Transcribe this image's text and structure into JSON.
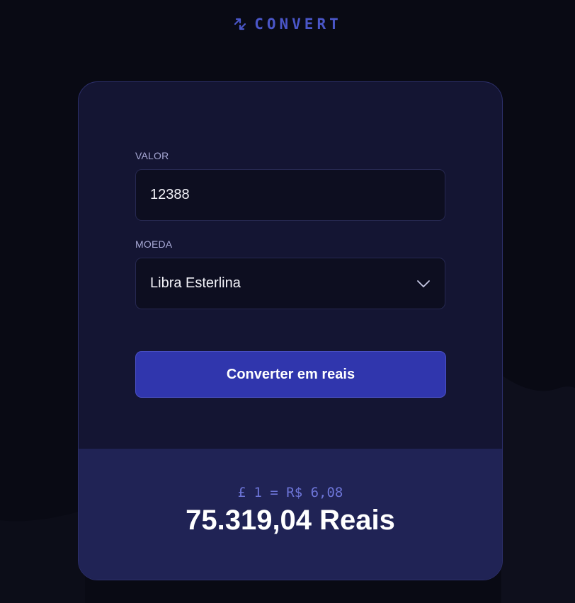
{
  "brand": {
    "icon": "swap-arrows-icon",
    "name": "CONVERT"
  },
  "form": {
    "amount_label": "VALOR",
    "amount_value": "12388",
    "currency_label": "MOEDA",
    "currency_selected": "Libra Esterlina",
    "submit_label": "Converter em reais"
  },
  "result": {
    "rate": "£ 1 = R$ 6,08",
    "total": "75.319,04 Reais"
  },
  "colors": {
    "background": "#090a14",
    "card": "#141533",
    "input": "#0d0e20",
    "accent": "#3036ad",
    "brand": "#4a56c8",
    "result_panel": "#202355",
    "rate_text": "#6d75d8"
  }
}
